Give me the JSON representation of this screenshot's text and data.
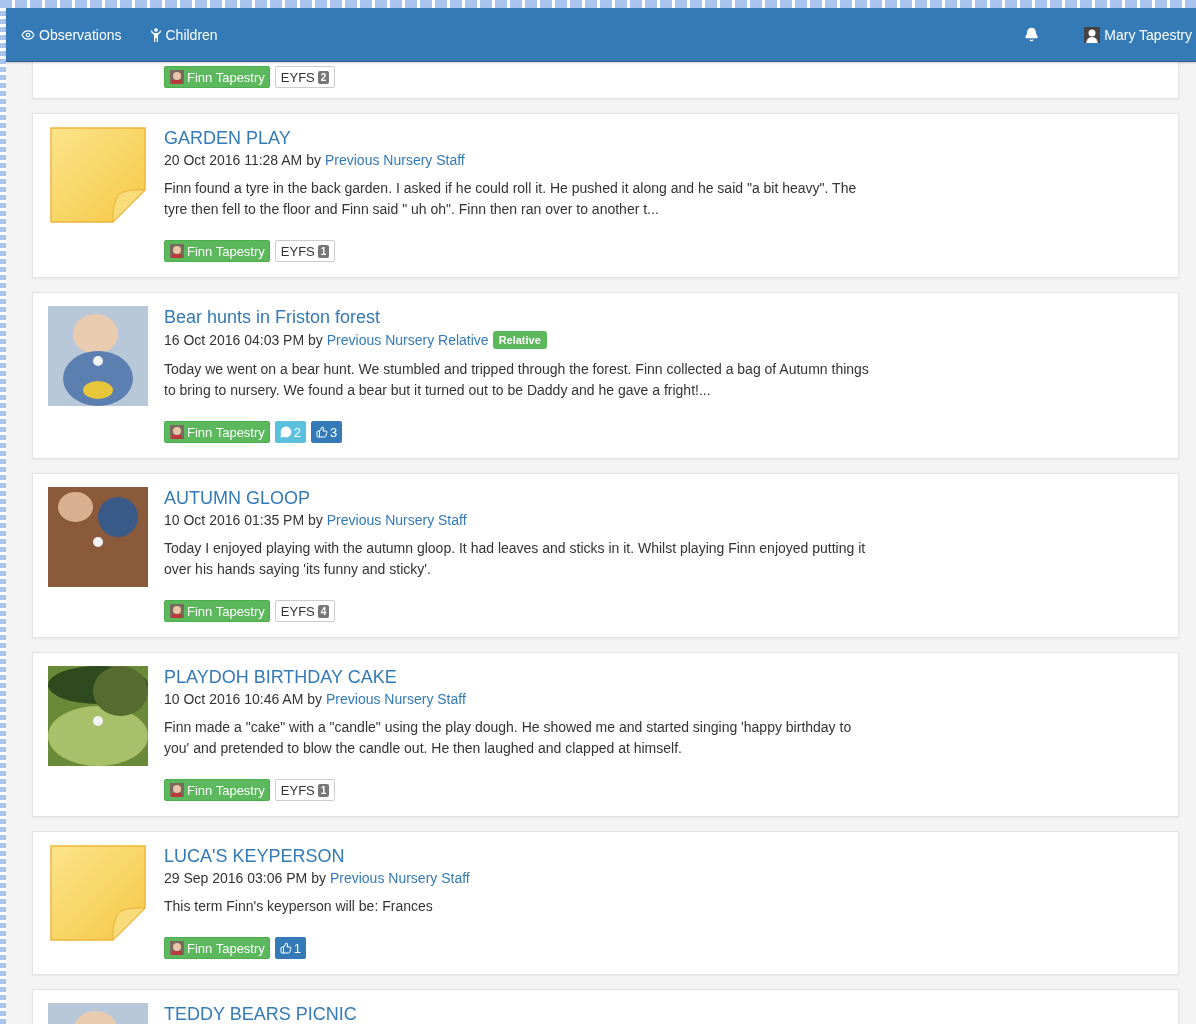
{
  "navbar": {
    "items": [
      {
        "label": "Observations"
      },
      {
        "label": "Children"
      }
    ],
    "user": {
      "name": "Mary Tapestry"
    }
  },
  "observations": [
    {
      "kind": "partial",
      "tags": [
        {
          "kind": "child",
          "label": "Finn Tapestry"
        },
        {
          "kind": "eyfs",
          "label": "EYFS",
          "count": "2"
        }
      ]
    },
    {
      "kind": "note",
      "title": "GARDEN PLAY",
      "date": "20 Oct 2016 11:28 AM",
      "by": "by",
      "author": "Previous Nursery Staff",
      "text": "Finn found a tyre in the back garden. I asked if he could roll it. He pushed it along and he said \"a bit heavy\". The tyre then fell to the floor and Finn said \" uh oh\". Finn then ran over to another t...",
      "tags": [
        {
          "kind": "child",
          "label": "Finn Tapestry"
        },
        {
          "kind": "eyfs",
          "label": "EYFS",
          "count": "1"
        }
      ]
    },
    {
      "title": "Bear hunts in Friston forest",
      "date": "16 Oct 2016 04:03 PM",
      "by": "by",
      "author": "Previous Nursery Relative",
      "badge": "Relative",
      "text": "Today we went on a bear hunt. We stumbled and tripped through the forest. Finn collected a bag of Autumn things to bring to nursery. We found a bear but it turned out to be Daddy and he gave a fright!...",
      "tags": [
        {
          "kind": "child",
          "label": "Finn Tapestry"
        },
        {
          "kind": "comments",
          "label": "2"
        },
        {
          "kind": "likes",
          "label": "3"
        }
      ]
    },
    {
      "title": "AUTUMN GLOOP",
      "date": "10 Oct 2016 01:35 PM",
      "by": "by",
      "author": "Previous Nursery Staff",
      "text": "Today I enjoyed playing with the autumn gloop. It had leaves and sticks in it. Whilst playing Finn enjoyed putting it over his hands saying 'its funny and sticky'.",
      "tags": [
        {
          "kind": "child",
          "label": "Finn Tapestry"
        },
        {
          "kind": "eyfs",
          "label": "EYFS",
          "count": "4"
        }
      ]
    },
    {
      "title": "PLAYDOH BIRTHDAY CAKE",
      "date": "10 Oct 2016 10:46 AM",
      "by": "by",
      "author": "Previous Nursery Staff",
      "text": "Finn made a \"cake\" with a \"candle\" using the play dough. He showed me and started singing 'happy birthday to you' and pretended to blow the candle out. He then laughed and clapped at himself.",
      "tags": [
        {
          "kind": "child",
          "label": "Finn Tapestry"
        },
        {
          "kind": "eyfs",
          "label": "EYFS",
          "count": "1"
        }
      ]
    },
    {
      "kind": "note",
      "title": "LUCA'S KEYPERSON",
      "date": "29 Sep 2016 03:06 PM",
      "by": "by",
      "author": "Previous Nursery Staff",
      "text": "This term Finn's keyperson will be: Frances",
      "tags": [
        {
          "kind": "child",
          "label": "Finn Tapestry"
        },
        {
          "kind": "likes",
          "label": "1"
        }
      ]
    },
    {
      "title": "TEDDY BEARS PICNIC"
    }
  ]
}
